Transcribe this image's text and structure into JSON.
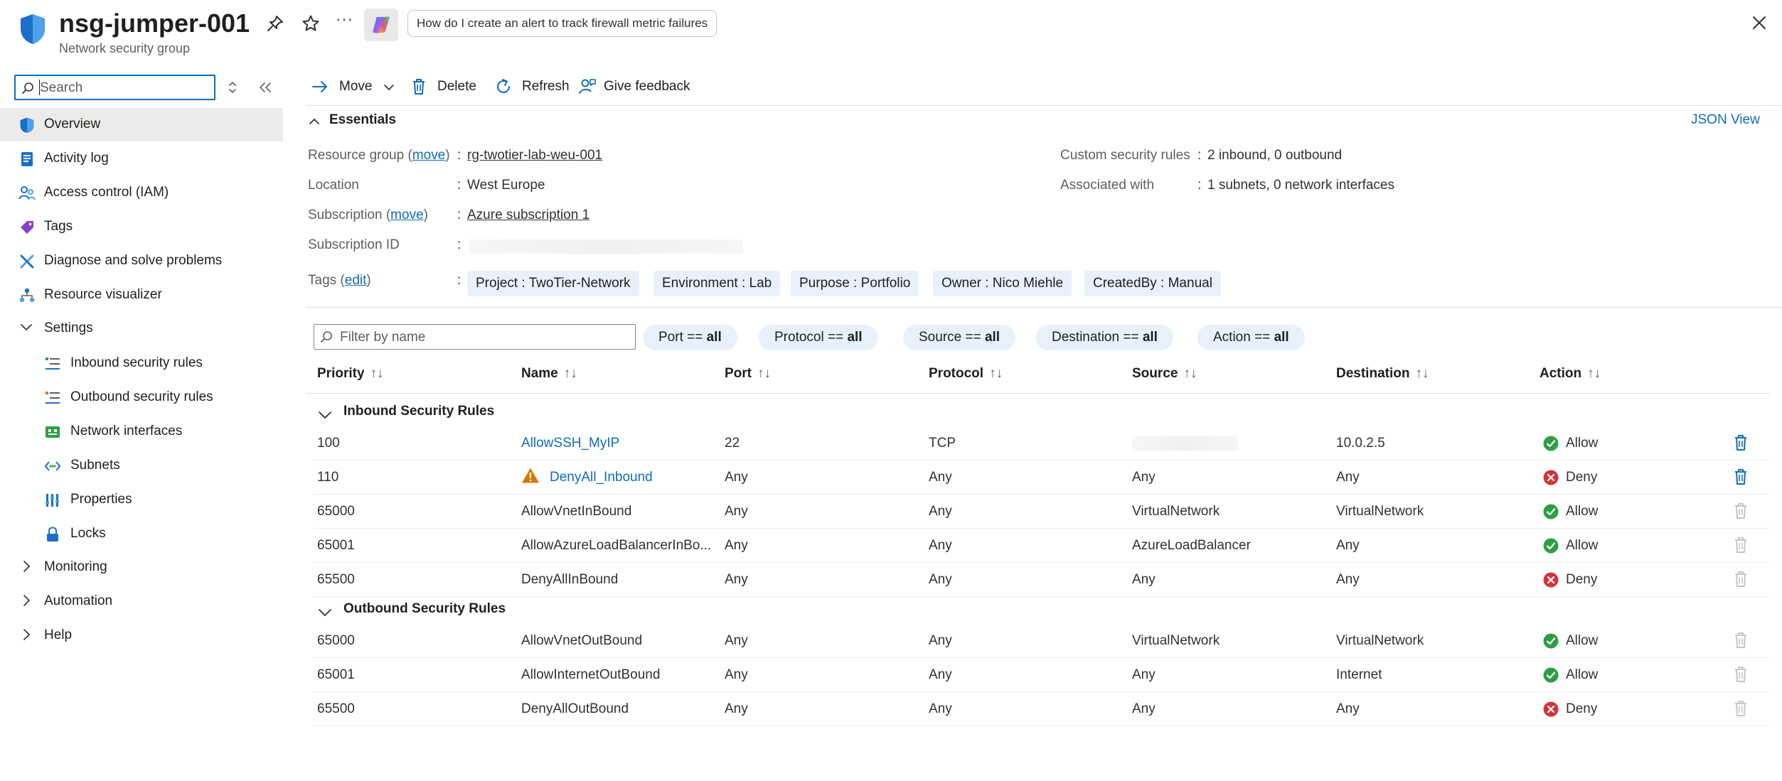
{
  "header": {
    "title": "nsg-jumper-001",
    "subtitle": "Network security group",
    "more": "···",
    "copilot_prompt": "How do I create an alert to track firewall metric failures"
  },
  "sidebar": {
    "search_placeholder": "Search",
    "items": [
      {
        "label": "Overview",
        "icon": "shield-icon",
        "active": true
      },
      {
        "label": "Activity log",
        "icon": "activity-log-icon"
      },
      {
        "label": "Access control (IAM)",
        "icon": "people-icon"
      },
      {
        "label": "Tags",
        "icon": "tag-icon"
      },
      {
        "label": "Diagnose and solve problems",
        "icon": "wrench-icon"
      },
      {
        "label": "Resource visualizer",
        "icon": "hierarchy-icon"
      },
      {
        "label": "Settings",
        "icon": "chevron-down-icon"
      },
      {
        "label": "Inbound security rules",
        "icon": "inbound-rules-icon"
      },
      {
        "label": "Outbound security rules",
        "icon": "outbound-rules-icon"
      },
      {
        "label": "Network interfaces",
        "icon": "network-interface-icon"
      },
      {
        "label": "Subnets",
        "icon": "subnet-icon"
      },
      {
        "label": "Properties",
        "icon": "properties-icon"
      },
      {
        "label": "Locks",
        "icon": "lock-icon"
      },
      {
        "label": "Monitoring",
        "icon": "chevron-right-icon"
      },
      {
        "label": "Automation",
        "icon": "chevron-right-icon"
      },
      {
        "label": "Help",
        "icon": "chevron-right-icon"
      }
    ]
  },
  "toolbar": {
    "move": "Move",
    "delete": "Delete",
    "refresh": "Refresh",
    "feedback": "Give feedback"
  },
  "essentials": {
    "title": "Essentials",
    "json_view": "JSON View",
    "resource_group_label": "Resource group",
    "move_link": "move",
    "resource_group_value": "rg-twotier-lab-weu-001",
    "location_label": "Location",
    "location_value": "West Europe",
    "subscription_label": "Subscription",
    "subscription_value": "Azure subscription 1",
    "subscription_id_label": "Subscription ID",
    "tags_label": "Tags",
    "edit_link": "edit",
    "custom_rules_label": "Custom security rules",
    "custom_rules_value": "2 inbound, 0 outbound",
    "associated_label": "Associated with",
    "associated_value": "1 subnets, 0 network interfaces",
    "colon": ":",
    "open_paren": "(",
    "close_paren": ")",
    "tags": [
      "Project : TwoTier-Network",
      "Environment : Lab",
      "Purpose : Portfolio",
      "Owner : Nico Miehle",
      "CreatedBy : Manual"
    ]
  },
  "filters": {
    "placeholder": "Filter by name",
    "pills": [
      {
        "key": "Port == ",
        "value": "all"
      },
      {
        "key": "Protocol == ",
        "value": "all"
      },
      {
        "key": "Source == ",
        "value": "all"
      },
      {
        "key": "Destination == ",
        "value": "all"
      },
      {
        "key": "Action == ",
        "value": "all"
      }
    ]
  },
  "table": {
    "sort_glyph": "↑↓",
    "columns": [
      "Priority",
      "Name",
      "Port",
      "Protocol",
      "Source",
      "Destination",
      "Action"
    ],
    "groups": [
      {
        "title": "Inbound Security Rules",
        "rows": [
          {
            "priority": "100",
            "name": "AllowSSH_MyIP",
            "port": "22",
            "protocol": "TCP",
            "source": "",
            "destination": "10.0.2.5",
            "action": "Allow",
            "link": true,
            "warning": false,
            "deletable": true
          },
          {
            "priority": "110",
            "name": "DenyAll_Inbound",
            "port": "Any",
            "protocol": "Any",
            "source": "Any",
            "destination": "Any",
            "action": "Deny",
            "link": true,
            "warning": true,
            "deletable": true
          },
          {
            "priority": "65000",
            "name": "AllowVnetInBound",
            "port": "Any",
            "protocol": "Any",
            "source": "VirtualNetwork",
            "destination": "VirtualNetwork",
            "action": "Allow",
            "link": false,
            "warning": false,
            "deletable": false
          },
          {
            "priority": "65001",
            "name": "AllowAzureLoadBalancerInBo...",
            "port": "Any",
            "protocol": "Any",
            "source": "AzureLoadBalancer",
            "destination": "Any",
            "action": "Allow",
            "link": false,
            "warning": false,
            "deletable": false
          },
          {
            "priority": "65500",
            "name": "DenyAllInBound",
            "port": "Any",
            "protocol": "Any",
            "source": "Any",
            "destination": "Any",
            "action": "Deny",
            "link": false,
            "warning": false,
            "deletable": false
          }
        ]
      },
      {
        "title": "Outbound Security Rules",
        "rows": [
          {
            "priority": "65000",
            "name": "AllowVnetOutBound",
            "port": "Any",
            "protocol": "Any",
            "source": "VirtualNetwork",
            "destination": "VirtualNetwork",
            "action": "Allow",
            "link": false,
            "warning": false,
            "deletable": false
          },
          {
            "priority": "65001",
            "name": "AllowInternetOutBound",
            "port": "Any",
            "protocol": "Any",
            "source": "Any",
            "destination": "Internet",
            "action": "Allow",
            "link": false,
            "warning": false,
            "deletable": false
          },
          {
            "priority": "65500",
            "name": "DenyAllOutBound",
            "port": "Any",
            "protocol": "Any",
            "source": "Any",
            "destination": "Any",
            "action": "Deny",
            "link": false,
            "warning": false,
            "deletable": false
          }
        ]
      }
    ]
  },
  "colors": {
    "accent": "#0f6cbd",
    "allow": "#2e9e44",
    "deny": "#d13438",
    "warning": "#d97706",
    "trash_active": "#0f6cbd",
    "trash_disabled": "#c8c6c4"
  }
}
